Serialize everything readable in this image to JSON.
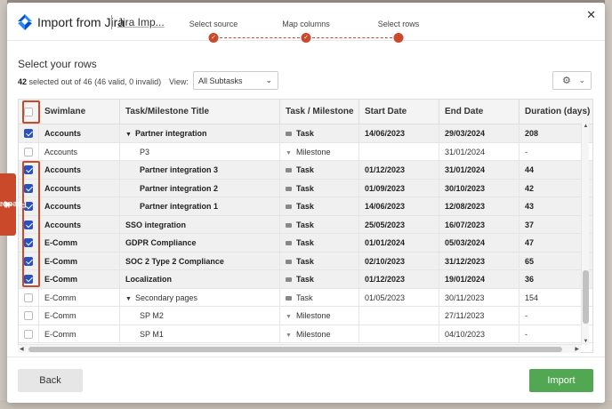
{
  "app": {
    "title": "Import from Jira",
    "subtitle": "Jira Imp..."
  },
  "steps": [
    "Select source",
    "Map columns",
    "Select rows"
  ],
  "section": {
    "title": "Select your rows",
    "count_bold": "42",
    "count_rest": " selected out of 46 (46 valid, 0 invalid)"
  },
  "view": {
    "label": "View:",
    "value": "All Subtasks"
  },
  "table": {
    "columns": [
      "Swimlane",
      "Task/Milestone Title",
      "Task / Milestone",
      "Start Date",
      "End Date",
      "Duration (days)"
    ],
    "rows": [
      {
        "checked": true,
        "swimlane": "Accounts",
        "title": "Partner integration",
        "type": "Task",
        "start": "14/06/2023",
        "end": "29/03/2024",
        "duration": "208"
      },
      {
        "checked": false,
        "swimlane": "Accounts",
        "title": "P3",
        "type": "Milestone",
        "start": "",
        "end": "31/01/2024",
        "duration": "-"
      },
      {
        "checked": true,
        "swimlane": "Accounts",
        "title": "Partner integration 3",
        "type": "Task",
        "start": "01/12/2023",
        "end": "31/01/2024",
        "duration": "44"
      },
      {
        "checked": true,
        "swimlane": "Accounts",
        "title": "Partner integration 2",
        "type": "Task",
        "start": "01/09/2023",
        "end": "30/10/2023",
        "duration": "42"
      },
      {
        "checked": true,
        "swimlane": "Accounts",
        "title": "Partner integration 1",
        "type": "Task",
        "start": "14/06/2023",
        "end": "12/08/2023",
        "duration": "43"
      },
      {
        "checked": true,
        "swimlane": "Accounts",
        "title": "SSO integration",
        "type": "Task",
        "start": "25/05/2023",
        "end": "16/07/2023",
        "duration": "37"
      },
      {
        "checked": true,
        "swimlane": "E-Comm",
        "title": "GDPR Compliance",
        "type": "Task",
        "start": "01/01/2024",
        "end": "05/03/2024",
        "duration": "47"
      },
      {
        "checked": true,
        "swimlane": "E-Comm",
        "title": "SOC 2 Type 2 Compliance",
        "type": "Task",
        "start": "02/10/2023",
        "end": "31/12/2023",
        "duration": "65"
      },
      {
        "checked": true,
        "swimlane": "E-Comm",
        "title": "Localization",
        "type": "Task",
        "start": "01/12/2023",
        "end": "19/01/2024",
        "duration": "36"
      },
      {
        "checked": false,
        "swimlane": "E-Comm",
        "title": "Secondary pages",
        "type": "Task",
        "start": "01/05/2023",
        "end": "30/11/2023",
        "duration": "154"
      },
      {
        "checked": false,
        "swimlane": "E-Comm",
        "title": "SP M2",
        "type": "Milestone",
        "start": "",
        "end": "27/11/2023",
        "duration": "-"
      },
      {
        "checked": false,
        "swimlane": "E-Comm",
        "title": "SP M1",
        "type": "Milestone",
        "start": "",
        "end": "04/10/2023",
        "duration": "-"
      }
    ]
  },
  "buttons": {
    "back": "Back",
    "import": "Import"
  },
  "feedback": "Feedback",
  "colors": {
    "accent": "#c9492a",
    "checkbox": "#2a52be",
    "import": "#52a852"
  }
}
